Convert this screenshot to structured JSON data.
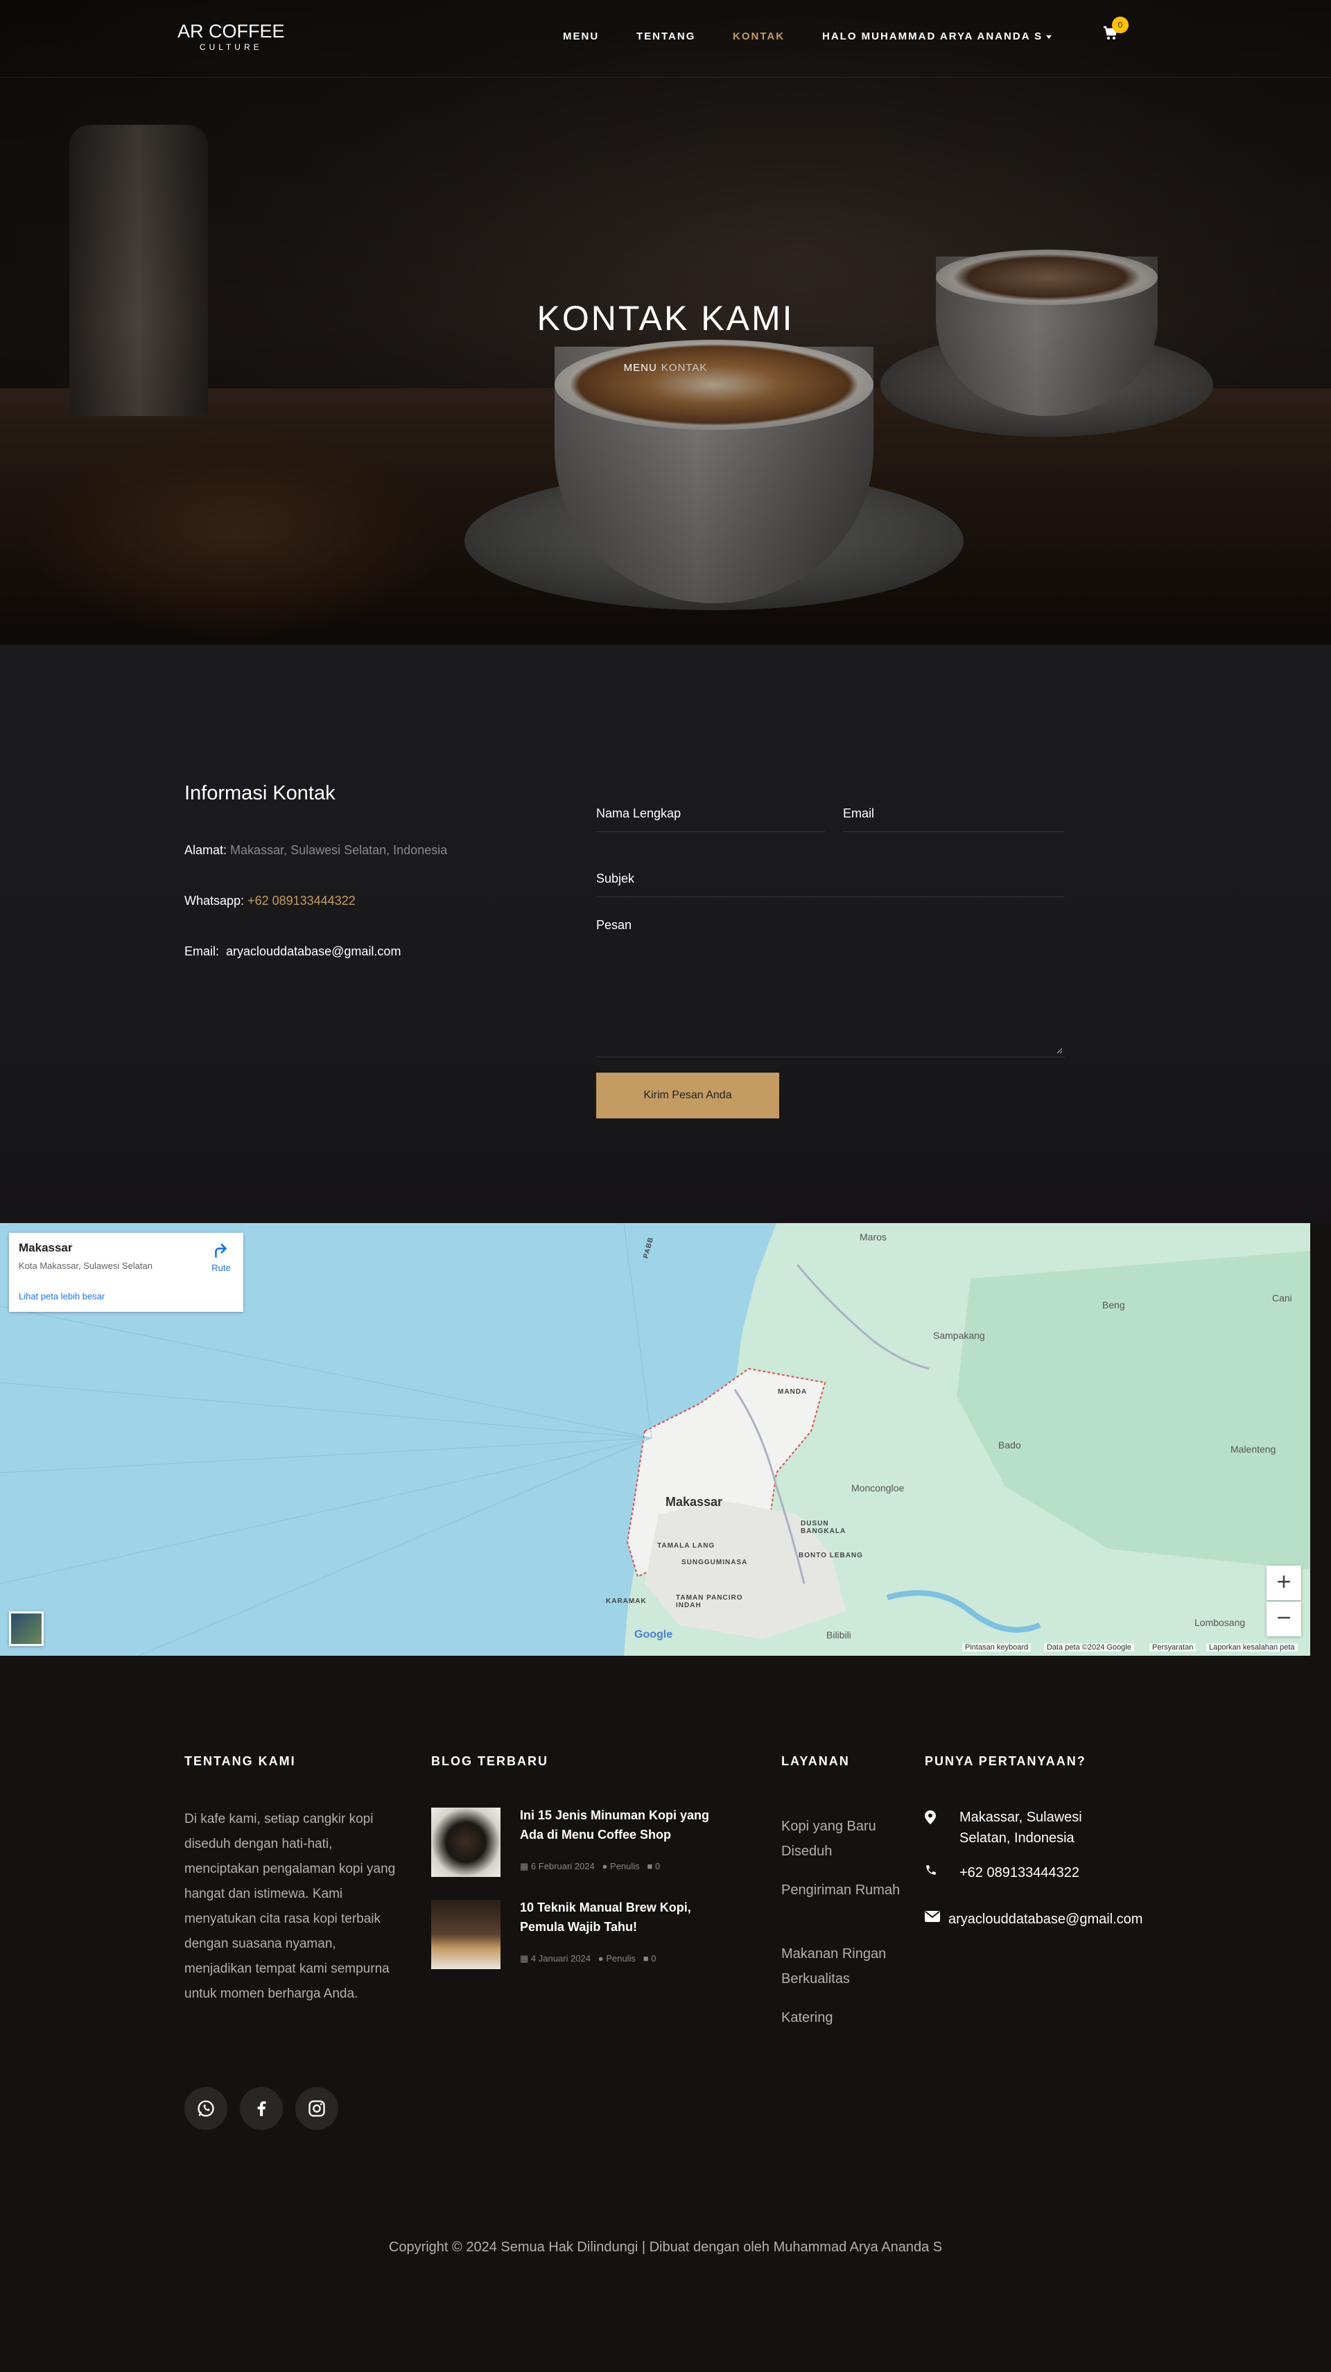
{
  "nav": {
    "logo_line1": "AR COFFEE",
    "logo_line2": "CULTURE",
    "links": [
      "MENU",
      "TENTANG",
      "KONTAK",
      "HALO MUHAMMAD ARYA ANANDA S"
    ],
    "active": "KONTAK",
    "cart_count": "0"
  },
  "hero": {
    "title": "KONTAK KAMI",
    "breadcrumb_home": "MENU",
    "breadcrumb_current": "KONTAK"
  },
  "contact_info": {
    "title": "Informasi Kontak",
    "address_label": "Alamat:",
    "address_value": "Makassar, Sulawesi Selatan, Indonesia",
    "whatsapp_label": "Whatsapp:",
    "whatsapp_value": "+62 089133444322",
    "email_label": "Email:",
    "email_value": "aryaclouddatabase@gmail.com"
  },
  "form": {
    "name_placeholder": "Nama Lengkap",
    "email_placeholder": "Email",
    "subject_placeholder": "Subjek",
    "message_placeholder": "Pesan",
    "submit_label": "Kirim Pesan Anda"
  },
  "map": {
    "card_title": "Makassar",
    "card_subtitle": "Kota Makassar, Sulawesi Selatan",
    "card_link": "Lihat peta lebih besar",
    "route_label": "Rute",
    "labels": [
      "Maros",
      "Beng",
      "Cani",
      "Sampakang",
      "MANDA",
      "Bado",
      "Malenteng",
      "Moncongloe",
      "Makassar",
      "DUSUN BANGKALA",
      "TAMALA LANG",
      "BONTO LEBANG",
      "SUNGGUMINASA",
      "KARAMAK",
      "TAMAN PANCIRO INDAH",
      "Bilibili",
      "Lombosang",
      "PABB"
    ],
    "footer_items": [
      "Pintasan keyboard",
      "Data peta ©2024 Google",
      "Persyaratan",
      "Laporkan kesalahan peta"
    ],
    "google": "Google",
    "zoom_in": "+",
    "zoom_out": "−"
  },
  "footer": {
    "about_title": "TENTANG KAMI",
    "about_text": "Di kafe kami, setiap cangkir kopi diseduh dengan hati-hati, menciptakan pengalaman kopi yang hangat dan istimewa. Kami menyatukan cita rasa kopi terbaik dengan suasana nyaman, menjadikan tempat kami sempurna untuk momen berharga Anda.",
    "social_icons": [
      "whatsapp-icon",
      "facebook-icon",
      "instagram-icon"
    ],
    "blog_title": "BLOG TERBARU",
    "posts": [
      {
        "title": "Ini 15 Jenis Minuman Kopi yang Ada di Menu Coffee Shop",
        "date": "6 Februari 2024",
        "author": "Penulis",
        "comments": "0"
      },
      {
        "title": "10 Teknik Manual Brew Kopi, Pemula Wajib Tahu!",
        "date": "4 Januari 2024",
        "author": "Penulis",
        "comments": "0"
      }
    ],
    "services_title": "LAYANAN",
    "services": [
      "Kopi yang Baru Diseduh",
      "Pengiriman Rumah",
      "Makanan Ringan Berkualitas",
      "Katering"
    ],
    "questions_title": "PUNYA PERTANYAAN?",
    "q_address": "Makassar, Sulawesi Selatan, Indonesia",
    "q_phone": "+62 089133444322",
    "q_email": "aryaclouddatabase@gmail.com",
    "copyright": "Copyright © 2024 Semua Hak Dilindungi | Dibuat dengan oleh Muhammad Arya Ananda S"
  },
  "colors": {
    "accent": "#c49b63",
    "background": "#151111",
    "badge": "#ffc107"
  }
}
